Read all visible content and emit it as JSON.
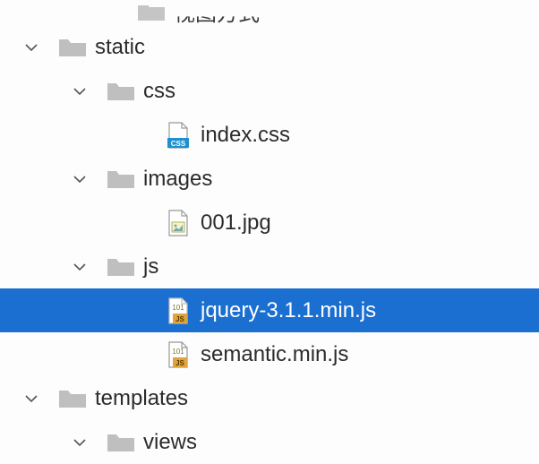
{
  "tree": {
    "truncated_label": "视图方式",
    "static": "static",
    "css_folder": "css",
    "index_css": "index.css",
    "images_folder": "images",
    "img_001": "001.jpg",
    "js_folder": "js",
    "jquery": "jquery-3.1.1.min.js",
    "semantic": "semantic.min.js",
    "templates_folder": "templates",
    "views_folder": "views"
  },
  "icons": {
    "folder": "folder-icon",
    "css": "css-file-icon",
    "image": "image-file-icon",
    "js": "js-file-icon"
  }
}
